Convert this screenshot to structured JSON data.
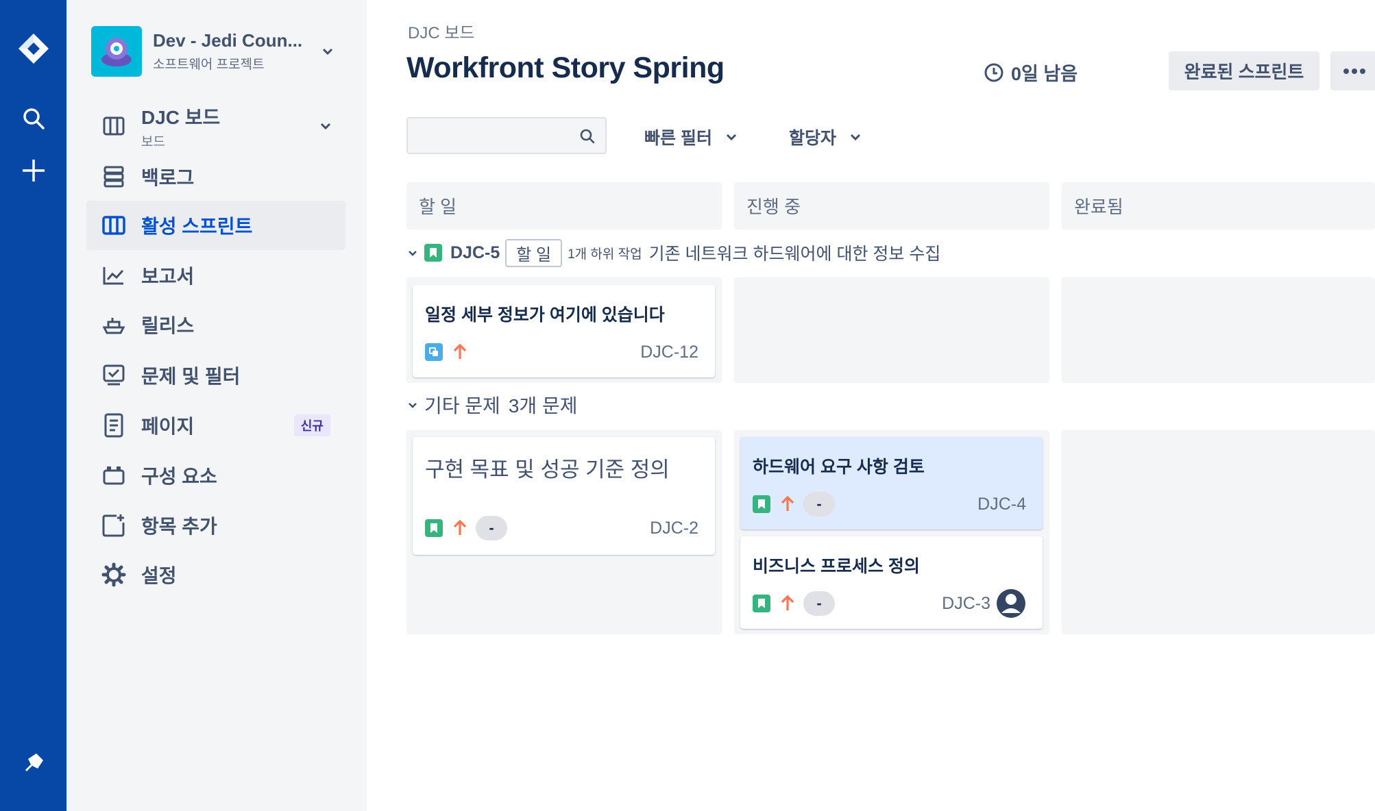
{
  "rail": {
    "icons": [
      "jira-logo-icon",
      "search-icon",
      "plus-icon",
      "notification-icon"
    ]
  },
  "project": {
    "name": "Dev - Jedi Coun...",
    "type": "소프트웨어 프로젝트"
  },
  "nav": {
    "board": {
      "label": "DJC 보드",
      "sub": "보드"
    },
    "items": [
      {
        "label": "백로그"
      },
      {
        "label": "활성 스프린트"
      },
      {
        "label": "보고서"
      },
      {
        "label": "릴리스"
      },
      {
        "label": "문제 및 필터"
      },
      {
        "label": "페이지",
        "badge": "신규"
      },
      {
        "label": "구성 요소"
      },
      {
        "label": "항목 추가"
      },
      {
        "label": "설정"
      }
    ]
  },
  "header": {
    "breadcrumb": "DJC 보드",
    "title": "Workfront Story Spring",
    "remaining": "0일 남음",
    "complete_button": "완료된 스프린트"
  },
  "toolbar": {
    "search_placeholder": "",
    "quick_filter": "빠른 필터",
    "assignee": "할당자"
  },
  "columns": [
    "할 일",
    "진행 중",
    "완료됨"
  ],
  "swimlane1": {
    "key": "DJC-5",
    "status": "할 일",
    "subtasks": "1개 하위 작업",
    "summary": "기존 네트워크 하드웨어에 대한 정보 수집",
    "card": {
      "title": "일정 세부 정보가 여기에 있습니다",
      "key": "DJC-12"
    }
  },
  "swimlane2": {
    "title": "기타 문제",
    "count": "3개 문제",
    "cards": [
      {
        "title": "구현 목표 및 성공 기준 정의",
        "key": "DJC-2",
        "estimate": "-"
      },
      {
        "title": "하드웨어 요구 사항 검토",
        "key": "DJC-4",
        "estimate": "-"
      },
      {
        "title": "비즈니스 프로세스 정의",
        "key": "DJC-3",
        "estimate": "-"
      }
    ]
  },
  "colors": {
    "rail": "#0747a6",
    "story": "#36b37e",
    "subtask": "#4bade8",
    "priority": "#ff7452",
    "active": "#0052cc"
  }
}
